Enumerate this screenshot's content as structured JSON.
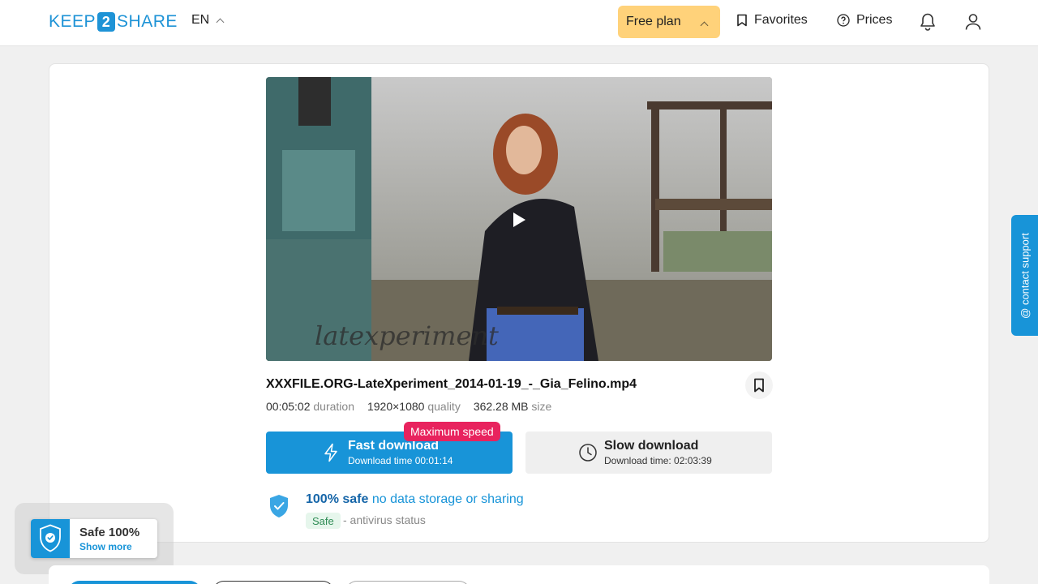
{
  "header": {
    "logo_left": "KEEP",
    "logo_mid": "2",
    "logo_right": "SHARE",
    "language": "EN",
    "plan_label": "Free plan",
    "favorites_label": "Favorites",
    "prices_label": "Prices"
  },
  "video": {
    "watermark": "latexperiment"
  },
  "file": {
    "name": "XXXFILE.ORG-LateXperiment_2014-01-19_-_Gia_Felino.mp4",
    "duration_value": "00:05:02",
    "duration_label": "duration",
    "quality_value": "1920×1080",
    "quality_label": "quality",
    "size_value": "362.28 MB",
    "size_label": "size"
  },
  "download": {
    "fast_badge": "Maximum speed",
    "fast_title": "Fast download",
    "fast_time": "Download time 00:01:14",
    "slow_title": "Slow download",
    "slow_time": "Download time: 02:03:39"
  },
  "safety": {
    "headline_bold": "100% safe",
    "headline_rest": "no data storage or sharing",
    "status_pill": "Safe",
    "status_text": "- antivirus status"
  },
  "sidebar": {
    "contact_label": "@ contact support"
  },
  "safe_widget": {
    "title": "Safe 100%",
    "link": "Show more"
  },
  "colors": {
    "accent": "#1894d8",
    "plan_bg": "#ffd27a",
    "badge": "#e8235e"
  }
}
